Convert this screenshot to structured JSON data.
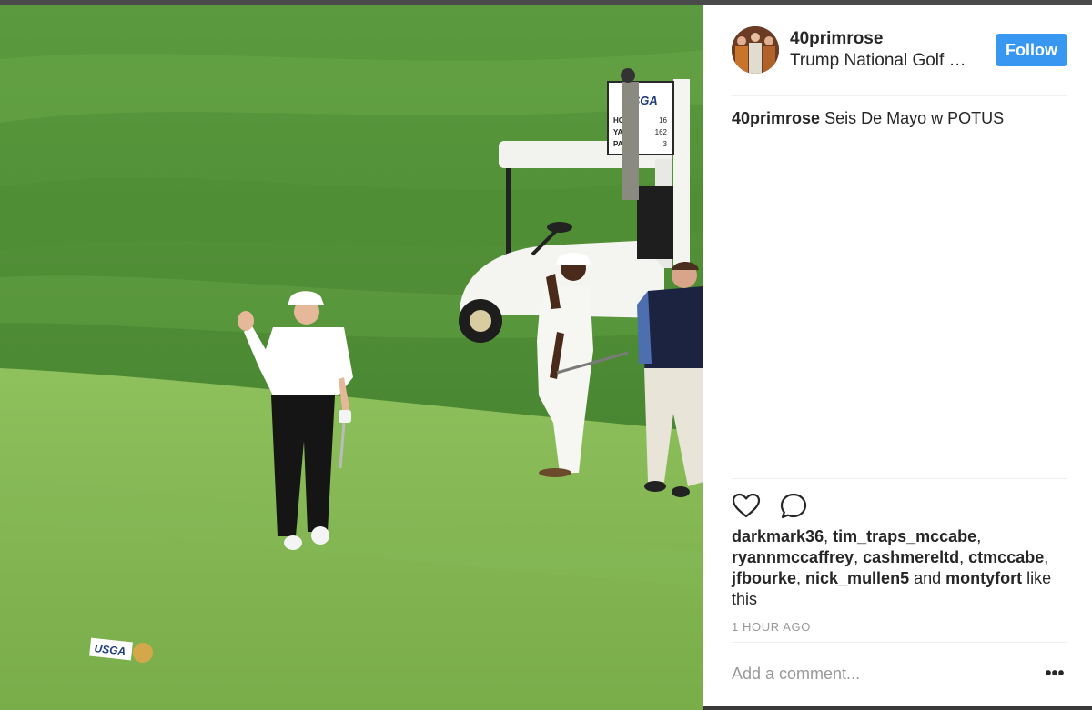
{
  "post": {
    "username": "40primrose",
    "location": "Trump National Golf Club",
    "follow_label": "Follow",
    "caption_user": "40primrose",
    "caption_text": " Seis De Mayo w POTUS",
    "likes": {
      "users": [
        "darkmark36",
        "tim_traps_mccabe",
        "ryannmccaffrey",
        "cashmereltd",
        "ctmccabe",
        "jfbourke",
        "nick_mullen5"
      ],
      "and_text": "and",
      "last_user": "montyfort",
      "suffix": "like this"
    },
    "time_ago": "1 HOUR AGO",
    "comment_placeholder": "Add a comment...",
    "more_label": "•••"
  },
  "photo_sign": {
    "logo": "USGA",
    "hole_label": "HOLE",
    "hole_value": "16",
    "yards_label": "YARDS",
    "yards_value": "162",
    "par_label": "PAR",
    "par_value": "3"
  },
  "tee_marker": {
    "logo": "USGA"
  },
  "colors": {
    "follow": "#3897f0",
    "text": "#262626",
    "muted": "#999999"
  },
  "icons": [
    "heart-icon",
    "comment-icon",
    "more-options-icon"
  ]
}
